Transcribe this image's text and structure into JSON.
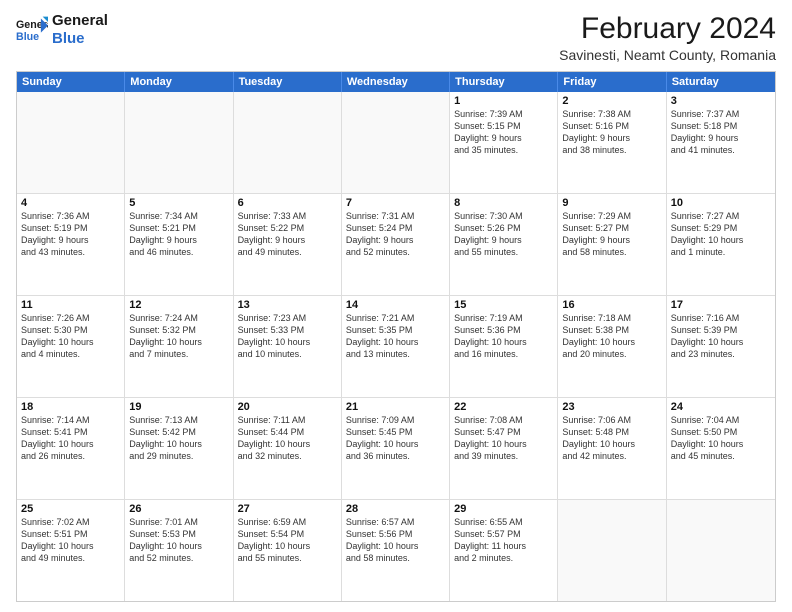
{
  "logo": {
    "line1": "General",
    "line2": "Blue"
  },
  "title": "February 2024",
  "subtitle": "Savinesti, Neamt County, Romania",
  "header_days": [
    "Sunday",
    "Monday",
    "Tuesday",
    "Wednesday",
    "Thursday",
    "Friday",
    "Saturday"
  ],
  "rows": [
    [
      {
        "day": "",
        "text": "",
        "empty": true
      },
      {
        "day": "",
        "text": "",
        "empty": true
      },
      {
        "day": "",
        "text": "",
        "empty": true
      },
      {
        "day": "",
        "text": "",
        "empty": true
      },
      {
        "day": "1",
        "text": "Sunrise: 7:39 AM\nSunset: 5:15 PM\nDaylight: 9 hours\nand 35 minutes."
      },
      {
        "day": "2",
        "text": "Sunrise: 7:38 AM\nSunset: 5:16 PM\nDaylight: 9 hours\nand 38 minutes."
      },
      {
        "day": "3",
        "text": "Sunrise: 7:37 AM\nSunset: 5:18 PM\nDaylight: 9 hours\nand 41 minutes."
      }
    ],
    [
      {
        "day": "4",
        "text": "Sunrise: 7:36 AM\nSunset: 5:19 PM\nDaylight: 9 hours\nand 43 minutes."
      },
      {
        "day": "5",
        "text": "Sunrise: 7:34 AM\nSunset: 5:21 PM\nDaylight: 9 hours\nand 46 minutes."
      },
      {
        "day": "6",
        "text": "Sunrise: 7:33 AM\nSunset: 5:22 PM\nDaylight: 9 hours\nand 49 minutes."
      },
      {
        "day": "7",
        "text": "Sunrise: 7:31 AM\nSunset: 5:24 PM\nDaylight: 9 hours\nand 52 minutes."
      },
      {
        "day": "8",
        "text": "Sunrise: 7:30 AM\nSunset: 5:26 PM\nDaylight: 9 hours\nand 55 minutes."
      },
      {
        "day": "9",
        "text": "Sunrise: 7:29 AM\nSunset: 5:27 PM\nDaylight: 9 hours\nand 58 minutes."
      },
      {
        "day": "10",
        "text": "Sunrise: 7:27 AM\nSunset: 5:29 PM\nDaylight: 10 hours\nand 1 minute."
      }
    ],
    [
      {
        "day": "11",
        "text": "Sunrise: 7:26 AM\nSunset: 5:30 PM\nDaylight: 10 hours\nand 4 minutes."
      },
      {
        "day": "12",
        "text": "Sunrise: 7:24 AM\nSunset: 5:32 PM\nDaylight: 10 hours\nand 7 minutes."
      },
      {
        "day": "13",
        "text": "Sunrise: 7:23 AM\nSunset: 5:33 PM\nDaylight: 10 hours\nand 10 minutes."
      },
      {
        "day": "14",
        "text": "Sunrise: 7:21 AM\nSunset: 5:35 PM\nDaylight: 10 hours\nand 13 minutes."
      },
      {
        "day": "15",
        "text": "Sunrise: 7:19 AM\nSunset: 5:36 PM\nDaylight: 10 hours\nand 16 minutes."
      },
      {
        "day": "16",
        "text": "Sunrise: 7:18 AM\nSunset: 5:38 PM\nDaylight: 10 hours\nand 20 minutes."
      },
      {
        "day": "17",
        "text": "Sunrise: 7:16 AM\nSunset: 5:39 PM\nDaylight: 10 hours\nand 23 minutes."
      }
    ],
    [
      {
        "day": "18",
        "text": "Sunrise: 7:14 AM\nSunset: 5:41 PM\nDaylight: 10 hours\nand 26 minutes."
      },
      {
        "day": "19",
        "text": "Sunrise: 7:13 AM\nSunset: 5:42 PM\nDaylight: 10 hours\nand 29 minutes."
      },
      {
        "day": "20",
        "text": "Sunrise: 7:11 AM\nSunset: 5:44 PM\nDaylight: 10 hours\nand 32 minutes."
      },
      {
        "day": "21",
        "text": "Sunrise: 7:09 AM\nSunset: 5:45 PM\nDaylight: 10 hours\nand 36 minutes."
      },
      {
        "day": "22",
        "text": "Sunrise: 7:08 AM\nSunset: 5:47 PM\nDaylight: 10 hours\nand 39 minutes."
      },
      {
        "day": "23",
        "text": "Sunrise: 7:06 AM\nSunset: 5:48 PM\nDaylight: 10 hours\nand 42 minutes."
      },
      {
        "day": "24",
        "text": "Sunrise: 7:04 AM\nSunset: 5:50 PM\nDaylight: 10 hours\nand 45 minutes."
      }
    ],
    [
      {
        "day": "25",
        "text": "Sunrise: 7:02 AM\nSunset: 5:51 PM\nDaylight: 10 hours\nand 49 minutes."
      },
      {
        "day": "26",
        "text": "Sunrise: 7:01 AM\nSunset: 5:53 PM\nDaylight: 10 hours\nand 52 minutes."
      },
      {
        "day": "27",
        "text": "Sunrise: 6:59 AM\nSunset: 5:54 PM\nDaylight: 10 hours\nand 55 minutes."
      },
      {
        "day": "28",
        "text": "Sunrise: 6:57 AM\nSunset: 5:56 PM\nDaylight: 10 hours\nand 58 minutes."
      },
      {
        "day": "29",
        "text": "Sunrise: 6:55 AM\nSunset: 5:57 PM\nDaylight: 11 hours\nand 2 minutes."
      },
      {
        "day": "",
        "text": "",
        "empty": true
      },
      {
        "day": "",
        "text": "",
        "empty": true
      }
    ]
  ]
}
